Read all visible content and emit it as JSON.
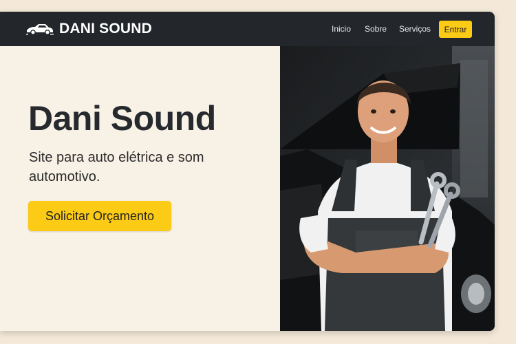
{
  "navbar": {
    "logo_icon": "car-icon",
    "brand_name": "DANI SOUND",
    "links": [
      "Inicio",
      "Sobre",
      "Serviços"
    ],
    "login_label": "Entrar",
    "accent_color": "#fccb15",
    "background_color": "#23272b"
  },
  "hero": {
    "title": "Dani Sound",
    "subtitle": "Site para auto elétrica e som automotivo.",
    "cta_label": "Solicitar Orçamento",
    "photo_subject": "mechanic-with-wrenches"
  }
}
